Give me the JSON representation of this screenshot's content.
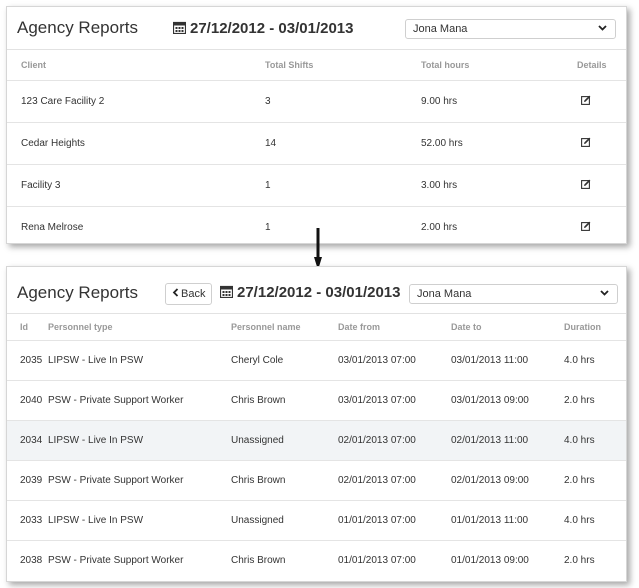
{
  "summary": {
    "title": "Agency Reports",
    "date_range": "27/12/2012 - 03/01/2013",
    "selected_user": "Jona Mana",
    "columns": [
      "Client",
      "Total Shifts",
      "Total hours",
      "Details"
    ],
    "rows": [
      {
        "client": "123 Care Facility 2",
        "total_shifts": "3",
        "total_hours": "9.00 hrs"
      },
      {
        "client": "Cedar Heights",
        "total_shifts": "14",
        "total_hours": "52.00 hrs"
      },
      {
        "client": "Facility 3",
        "total_shifts": "1",
        "total_hours": "3.00 hrs"
      },
      {
        "client": "Rena Melrose",
        "total_shifts": "1",
        "total_hours": "2.00 hrs"
      }
    ]
  },
  "details": {
    "title": "Agency Reports",
    "back_label": "Back",
    "date_range": "27/12/2012 - 03/01/2013",
    "selected_user": "Jona Mana",
    "columns": [
      "Id",
      "Personnel type",
      "Personnel name",
      "Date from",
      "Date to",
      "Duration"
    ],
    "rows": [
      {
        "id": "2035",
        "type": "LIPSW - Live In PSW",
        "name": "Cheryl Cole",
        "from": "03/01/2013 07:00",
        "to": "03/01/2013 11:00",
        "duration": "4.0 hrs"
      },
      {
        "id": "2040",
        "type": "PSW - Private Support Worker",
        "name": "Chris Brown",
        "from": "03/01/2013 07:00",
        "to": "03/01/2013 09:00",
        "duration": "2.0 hrs"
      },
      {
        "id": "2034",
        "type": "LIPSW - Live In PSW",
        "name": "Unassigned",
        "from": "02/01/2013 07:00",
        "to": "02/01/2013 11:00",
        "duration": "4.0 hrs"
      },
      {
        "id": "2039",
        "type": "PSW - Private Support Worker",
        "name": "Chris Brown",
        "from": "02/01/2013 07:00",
        "to": "02/01/2013 09:00",
        "duration": "2.0 hrs"
      },
      {
        "id": "2033",
        "type": "LIPSW - Live In PSW",
        "name": "Unassigned",
        "from": "01/01/2013 07:00",
        "to": "01/01/2013 11:00",
        "duration": "4.0 hrs"
      },
      {
        "id": "2038",
        "type": "PSW - Private Support Worker",
        "name": "Chris Brown",
        "from": "01/01/2013 07:00",
        "to": "01/01/2013 09:00",
        "duration": "2.0 hrs"
      }
    ]
  },
  "icons": {
    "calendar": "calendar-icon",
    "edit": "edit-icon",
    "chevron": "chevron-down-icon",
    "back": "chevron-left-icon",
    "arrow": "arrow-down-icon"
  }
}
